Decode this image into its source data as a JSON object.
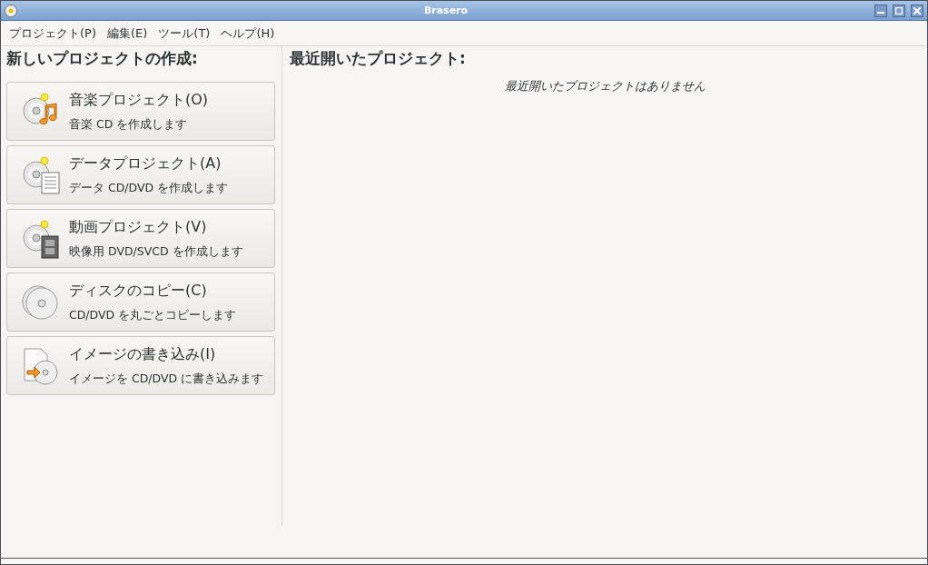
{
  "window": {
    "title": "Brasero"
  },
  "menu": [
    "プロジェクト(P)",
    "編集(E)",
    "ツール(T)",
    "ヘルプ(H)"
  ],
  "new_project": {
    "heading": "新しいプロジェクトの作成:",
    "items": [
      {
        "kind": "audio",
        "title": "音楽プロジェクト(O)",
        "description": "音楽 CD を作成します"
      },
      {
        "kind": "data",
        "title": "データプロジェクト(A)",
        "description": "データ CD/DVD を作成します"
      },
      {
        "kind": "video",
        "title": "動画プロジェクト(V)",
        "description": "映像用 DVD/SVCD を作成します"
      },
      {
        "kind": "copy",
        "title": "ディスクのコピー(C)",
        "description": "CD/DVD を丸ごとコピーします"
      },
      {
        "kind": "image",
        "title": "イメージの書き込み(I)",
        "description": "イメージを CD/DVD に書き込みます"
      }
    ]
  },
  "recent": {
    "heading": "最近開いたプロジェクト:",
    "empty_message": "最近開いたプロジェクトはありません"
  }
}
